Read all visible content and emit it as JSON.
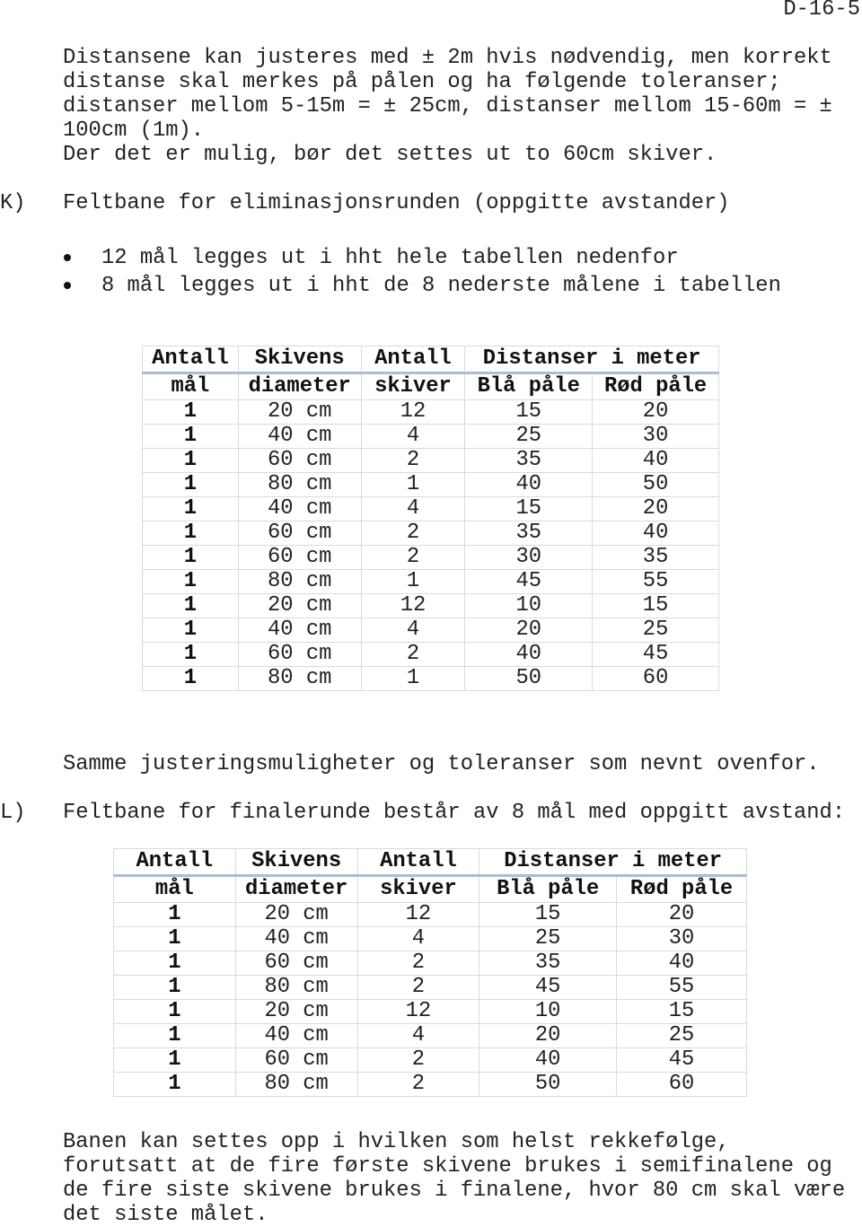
{
  "page_number": "D-16-5",
  "intro_lines": [
    "Distansene kan justeres med ± 2m hvis nødvendig, men korrekt",
    "distanse skal merkes på pålen og ha følgende toleranser;",
    "distanser mellom 5-15m = ± 25cm, distanser mellom 15-60m = ±",
    "100cm (1m).",
    "Der det er mulig, bør det settes ut to 60cm skiver."
  ],
  "section_k": {
    "label": "K)",
    "title": "Feltbane for eliminasjonsrunden (oppgitte avstander)",
    "bullets": [
      "12 mål legges ut i hht hele tabellen nedenfor",
      "8 mål legges ut i hht de 8 nederste målene i tabellen"
    ],
    "table": {
      "header1": [
        "Antall",
        "Skivens",
        "Antall",
        "Distanser i meter"
      ],
      "header2": [
        "mål",
        "diameter",
        "skiver",
        "Blå påle",
        "Rød påle"
      ],
      "rows": [
        [
          "1",
          "20 cm",
          "12",
          "15",
          "20"
        ],
        [
          "1",
          "40 cm",
          "4",
          "25",
          "30"
        ],
        [
          "1",
          "60 cm",
          "2",
          "35",
          "40"
        ],
        [
          "1",
          "80 cm",
          "1",
          "40",
          "50"
        ],
        [
          "1",
          "40 cm",
          "4",
          "15",
          "20"
        ],
        [
          "1",
          "60 cm",
          "2",
          "35",
          "40"
        ],
        [
          "1",
          "60 cm",
          "2",
          "30",
          "35"
        ],
        [
          "1",
          "80 cm",
          "1",
          "45",
          "55"
        ],
        [
          "1",
          "20 cm",
          "12",
          "10",
          "15"
        ],
        [
          "1",
          "40 cm",
          "4",
          "20",
          "25"
        ],
        [
          "1",
          "60 cm",
          "2",
          "40",
          "45"
        ],
        [
          "1",
          "80 cm",
          "1",
          "50",
          "60"
        ]
      ]
    },
    "note": "Samme justeringsmuligheter og toleranser som nevnt ovenfor."
  },
  "section_l": {
    "label": "L)",
    "title": "Feltbane for finalerunde består av 8 mål med oppgitt avstand:",
    "table": {
      "header1": [
        "Antall",
        "Skivens",
        "Antall",
        "Distanser i meter"
      ],
      "header2": [
        "mål",
        "diameter",
        "skiver",
        "Blå påle",
        "Rød påle"
      ],
      "rows": [
        [
          "1",
          "20 cm",
          "12",
          "15",
          "20"
        ],
        [
          "1",
          "40 cm",
          "4",
          "25",
          "30"
        ],
        [
          "1",
          "60 cm",
          "2",
          "35",
          "40"
        ],
        [
          "1",
          "80 cm",
          "2",
          "45",
          "55"
        ],
        [
          "1",
          "20 cm",
          "12",
          "10",
          "15"
        ],
        [
          "1",
          "40 cm",
          "4",
          "20",
          "25"
        ],
        [
          "1",
          "60 cm",
          "2",
          "40",
          "45"
        ],
        [
          "1",
          "80 cm",
          "2",
          "50",
          "60"
        ]
      ]
    }
  },
  "closing_lines": [
    "Banen kan settes opp i hvilken som helst rekkefølge,",
    "forutsatt at de fire første skivene brukes i semifinalene og",
    "de fire siste skivene brukes i finalene, hvor 80 cm skal være",
    "det siste målet."
  ]
}
